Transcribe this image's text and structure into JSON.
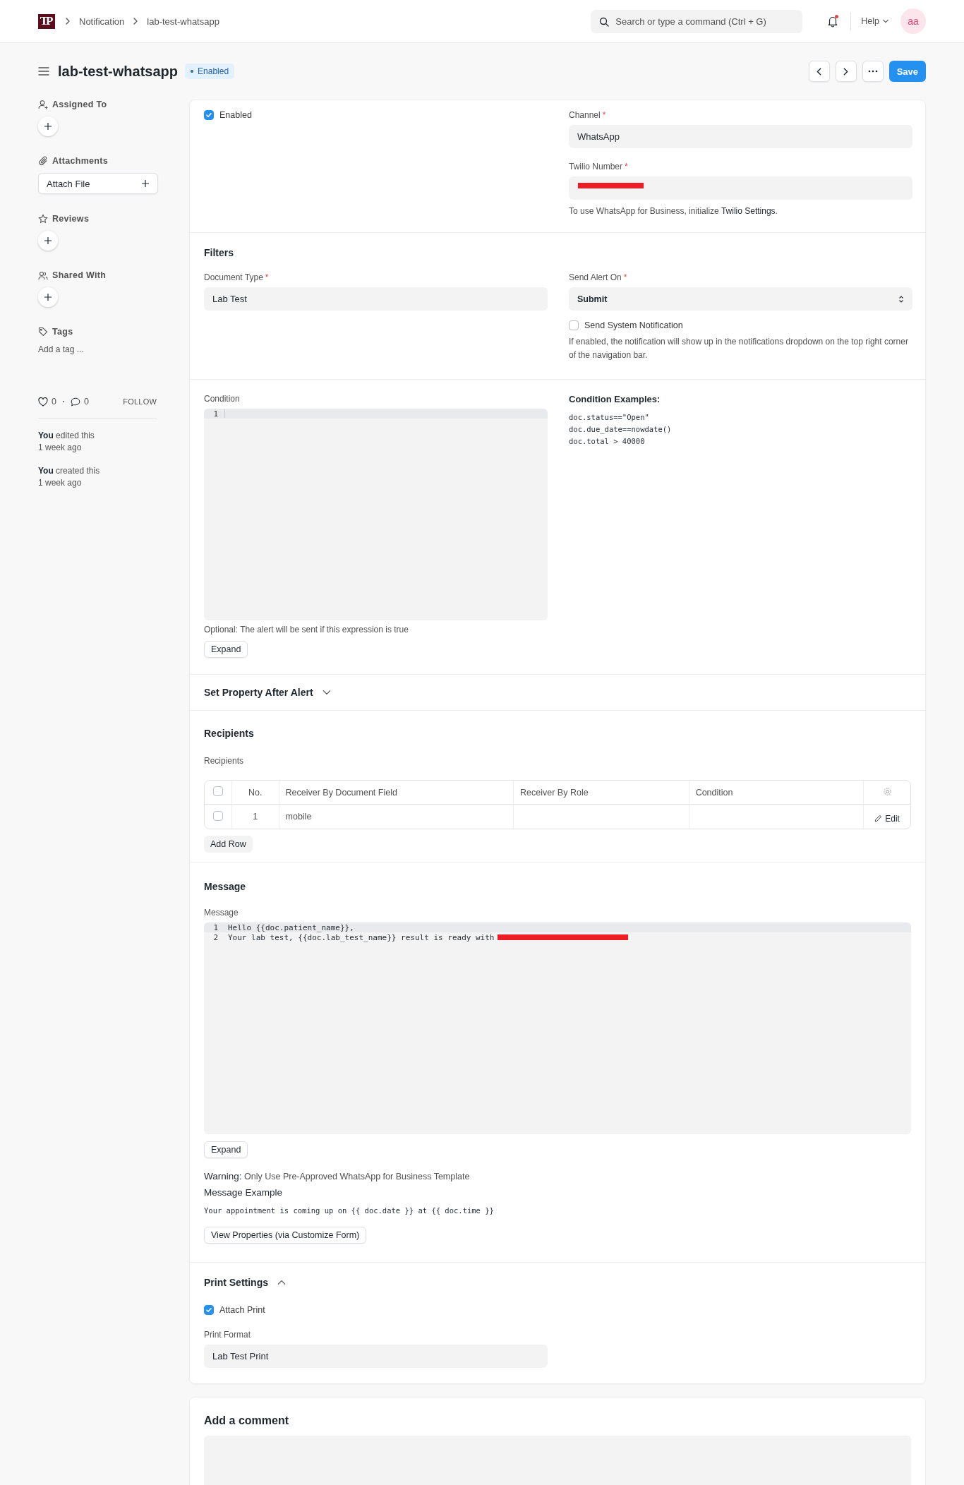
{
  "navbar": {
    "logo": "TP",
    "breadcrumbs": [
      "Notification",
      "lab-test-whatsapp"
    ],
    "search": {
      "placeholder": "Search or type a command (Ctrl + G)"
    },
    "notifications_unread": true,
    "help": "Help",
    "avatar": "aa"
  },
  "header": {
    "title": "lab-test-whatsapp",
    "status": "Enabled",
    "save": "Save"
  },
  "sidebar": {
    "sections": [
      {
        "kind": "add",
        "label": "Assigned To"
      },
      {
        "kind": "attach",
        "label": "Attachments",
        "button": "Attach File"
      },
      {
        "kind": "add",
        "label": "Reviews"
      },
      {
        "kind": "add",
        "label": "Shared With"
      },
      {
        "kind": "tags",
        "label": "Tags",
        "placeholder": "Add a tag ..."
      }
    ],
    "likes": "0",
    "comments": "0",
    "follow": "FOLLOW",
    "activity": [
      {
        "text": "**You** edited this",
        "time": "1 week ago"
      },
      {
        "text": "**You** created this",
        "time": "1 week ago"
      }
    ]
  },
  "form": {
    "enabled": {
      "label": "Enabled",
      "checked": true
    },
    "channel": {
      "label": "Channel",
      "required_mark": "*",
      "value": "WhatsApp"
    },
    "twilio_number": {
      "label": "Twilio Number",
      "required_mark": "*",
      "redacted": true
    },
    "twilio_hint": {
      "text": "To use WhatsApp for Business, initialize ",
      "link": "Twilio Settings",
      "after": "."
    },
    "filters": {
      "title": "Filters",
      "document_type": {
        "label": "Document Type",
        "required_mark": "*",
        "value": "Lab Test"
      },
      "send_alert_on": {
        "label": "Send Alert On",
        "required_mark": "*",
        "value": "Submit"
      },
      "send_system_notification": {
        "label": "Send System Notification",
        "checked": false,
        "hint": "If enabled, the notification will show up in the notifications dropdown on the top right corner of the navigation bar."
      }
    },
    "condition": {
      "label": "Condition",
      "lines": [
        {
          "no": "1"
        }
      ],
      "hint": "Optional: The alert will be sent if this expression is true",
      "expand": "Expand",
      "examples_title": "Condition Examples:",
      "examples": [
        "doc.status==\"Open\"",
        "doc.due_date==nowdate()",
        "doc.total > 40000"
      ]
    },
    "set_property": {
      "title": "Set Property After Alert",
      "expanded": false
    },
    "recipients": {
      "title": "Recipients",
      "label": "Recipients",
      "select_all": false,
      "columns": [
        "No.",
        "Receiver By Document Field",
        "Receiver By Role",
        "Condition"
      ],
      "rows": [
        {
          "no": "1",
          "receiver_by_document_field": "mobile",
          "selected": false,
          "edit": "Edit"
        }
      ],
      "add_row": "Add Row"
    },
    "message": {
      "title": "Message",
      "label": "Message",
      "lines": [
        {
          "no": "1",
          "code": "Hello {{doc.patient_name}},"
        },
        {
          "no": "2",
          "code": "Your lab test, {{doc.lab_test_name}} result is ready with",
          "redacted": true
        }
      ],
      "expand": "Expand",
      "warning": "**Warning:** Only Use Pre-Approved WhatsApp for Business Template",
      "example_title": "Message Example",
      "example": "Your appointment is coming up on {{ doc.date }} at {{ doc.time }}",
      "view_properties": "View Properties (via Customize Form)"
    },
    "print_settings": {
      "title": "Print Settings",
      "expanded": true,
      "attach_print": {
        "label": "Attach Print",
        "checked": true
      },
      "print_format": {
        "label": "Print Format",
        "value": "Lab Test Print"
      }
    }
  },
  "comment": {
    "title": "Add a comment"
  }
}
